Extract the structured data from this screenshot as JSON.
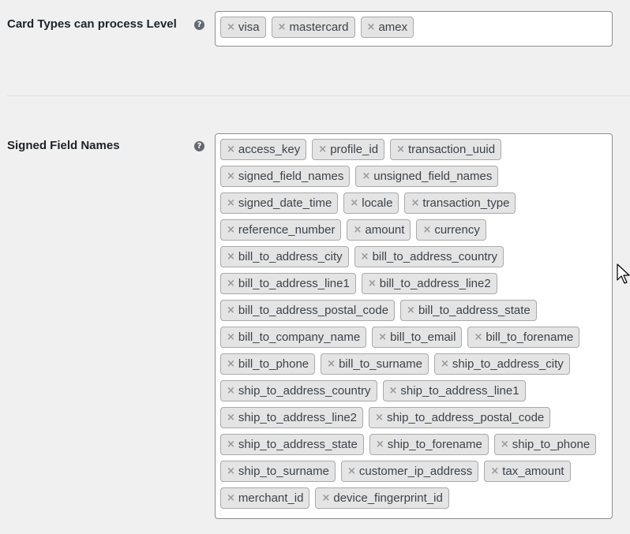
{
  "card_types": {
    "label": "Card Types can process Level",
    "help_glyph": "?",
    "remove_glyph": "×",
    "tags": [
      "visa",
      "mastercard",
      "amex"
    ]
  },
  "signed_fields": {
    "label": "Signed Field Names",
    "help_glyph": "?",
    "remove_glyph": "×",
    "tags": [
      "access_key",
      "profile_id",
      "transaction_uuid",
      "signed_field_names",
      "unsigned_field_names",
      "signed_date_time",
      "locale",
      "transaction_type",
      "reference_number",
      "amount",
      "currency",
      "bill_to_address_city",
      "bill_to_address_country",
      "bill_to_address_line1",
      "bill_to_address_line2",
      "bill_to_address_postal_code",
      "bill_to_address_state",
      "bill_to_company_name",
      "bill_to_email",
      "bill_to_forename",
      "bill_to_phone",
      "bill_to_surname",
      "ship_to_address_city",
      "ship_to_address_country",
      "ship_to_address_line1",
      "ship_to_address_line2",
      "ship_to_address_postal_code",
      "ship_to_address_state",
      "ship_to_forename",
      "ship_to_phone",
      "ship_to_surname",
      "customer_ip_address",
      "tax_amount",
      "merchant_id",
      "device_fingerprint_id"
    ]
  },
  "icons": {
    "help": "question-circle-icon",
    "remove": "close-icon",
    "cursor": "mouse-pointer-icon"
  },
  "colors": {
    "page_background": "#f0f0f1",
    "tag_background": "#e4e4e4",
    "tag_border": "#aaaaaa",
    "help_icon": "#646970"
  }
}
